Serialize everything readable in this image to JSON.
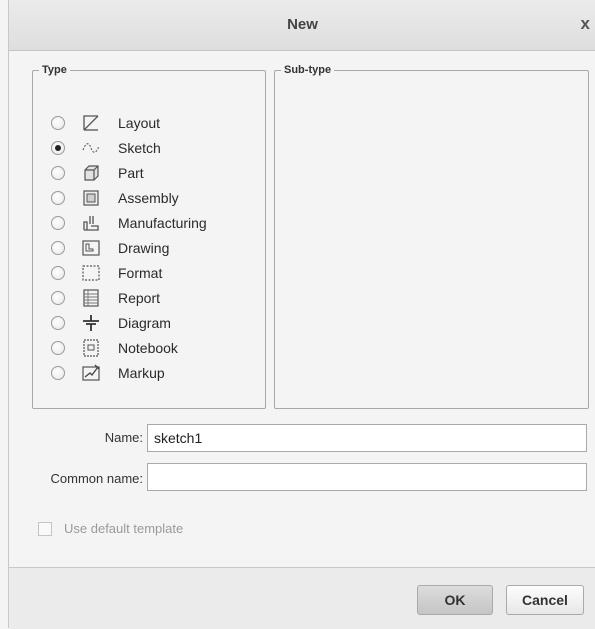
{
  "window": {
    "title": "New",
    "close_glyph": "x"
  },
  "type_group": {
    "legend": "Type",
    "selected": "Sketch",
    "items": [
      {
        "label": "Layout",
        "icon": "layout-icon",
        "checked": false
      },
      {
        "label": "Sketch",
        "icon": "sketch-icon",
        "checked": true
      },
      {
        "label": "Part",
        "icon": "part-icon",
        "checked": false
      },
      {
        "label": "Assembly",
        "icon": "assembly-icon",
        "checked": false
      },
      {
        "label": "Manufacturing",
        "icon": "manufacturing-icon",
        "checked": false
      },
      {
        "label": "Drawing",
        "icon": "drawing-icon",
        "checked": false
      },
      {
        "label": "Format",
        "icon": "format-icon",
        "checked": false
      },
      {
        "label": "Report",
        "icon": "report-icon",
        "checked": false
      },
      {
        "label": "Diagram",
        "icon": "diagram-icon",
        "checked": false
      },
      {
        "label": "Notebook",
        "icon": "notebook-icon",
        "checked": false
      },
      {
        "label": "Markup",
        "icon": "markup-icon",
        "checked": false
      }
    ]
  },
  "subtype_group": {
    "legend": "Sub-type"
  },
  "form": {
    "name_label": "Name:",
    "name_value": "sketch1",
    "common_name_label": "Common name:",
    "common_name_value": ""
  },
  "options": {
    "use_default_template_label": "Use default template",
    "use_default_template_enabled": false
  },
  "buttons": {
    "ok_label": "OK",
    "cancel_label": "Cancel"
  }
}
